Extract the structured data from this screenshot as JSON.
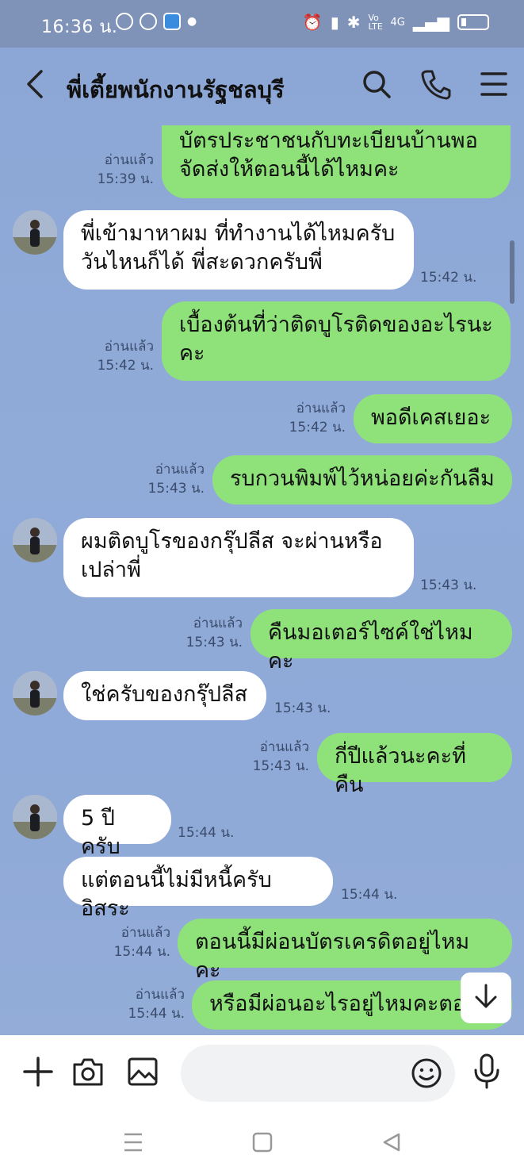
{
  "status_bar": {
    "time": "16:36 น.",
    "net_label": "Vo LTE",
    "signal_label": "4G"
  },
  "header": {
    "back_label": "<",
    "title": "พี่เตี้ยพนักงานรัฐชลบุรี"
  },
  "messages": [
    {
      "side": "out",
      "lines": [
        "บัตรประชาชนกับทะเบียนบ้านพอ",
        "จัดส่งให้ตอนนี้ได้ไหมคะ"
      ],
      "read": "อ่านแล้ว",
      "time": "15:39 น."
    },
    {
      "side": "in",
      "lines": [
        "พี่เข้ามาหาผม ที่ทำงานได้ไหมครับ",
        "วันไหนก็ได้ พี่สะดวกครับพี่"
      ],
      "time": "15:42 น."
    },
    {
      "side": "out",
      "lines": [
        "เบื้องต้นที่ว่าติดบูโรติดของอะไรนะ",
        "คะ"
      ],
      "read": "อ่านแล้ว",
      "time": "15:42 น."
    },
    {
      "side": "out",
      "lines": [
        "พอดีเคสเยอะ"
      ],
      "read": "อ่านแล้ว",
      "time": "15:42 น."
    },
    {
      "side": "out",
      "lines": [
        "รบกวนพิมพ์ไว้หน่อยค่ะกันลืม"
      ],
      "read": "อ่านแล้ว",
      "time": "15:43 น."
    },
    {
      "side": "in",
      "lines": [
        "ผมติดบูโรของกรุ๊ปลีส จะผ่านหรือ",
        "เปล่าพี่"
      ],
      "time": "15:43 น."
    },
    {
      "side": "out",
      "lines": [
        "คืนมอเตอร์ไซค์ใช่ไหมคะ"
      ],
      "read": "อ่านแล้ว",
      "time": "15:43 น."
    },
    {
      "side": "in",
      "lines": [
        "ใช่ครับของกรุ๊ปลีส"
      ],
      "time": "15:43 น."
    },
    {
      "side": "out",
      "lines": [
        "กี่ปีแล้วนะคะที่คืน"
      ],
      "read": "อ่านแล้ว",
      "time": "15:43 น."
    },
    {
      "side": "in",
      "lines": [
        "5 ปีครับ"
      ],
      "time": "15:44 น."
    },
    {
      "side": "in",
      "lines": [
        "แต่ตอนนี้ไม่มีหนี้ครับอิสระ"
      ],
      "time": "15:44 น."
    },
    {
      "side": "out",
      "lines": [
        "ตอนนี้มีผ่อนบัตรเครดิตอยู่ไหมคะ"
      ],
      "read": "อ่านแล้ว",
      "time": "15:44 น."
    },
    {
      "side": "out",
      "lines": [
        "หรือมีผ่อนอะไรอยู่ไหมคะตอ"
      ],
      "read": "อ่านแล้ว",
      "time": "15:44 น."
    }
  ],
  "icons": {
    "header": [
      "search-icon",
      "phone-icon",
      "menu-icon"
    ],
    "input": [
      "plus-icon",
      "camera-icon",
      "image-icon",
      "emoji-icon",
      "mic-icon"
    ],
    "nav": [
      "recent-apps-icon",
      "home-icon",
      "back-icon"
    ]
  },
  "colors": {
    "outgoing_bubble": "#8fe27a",
    "incoming_bubble": "#ffffff",
    "chat_bg": "#8ca6d5",
    "status_bar": "#7f92b8"
  }
}
